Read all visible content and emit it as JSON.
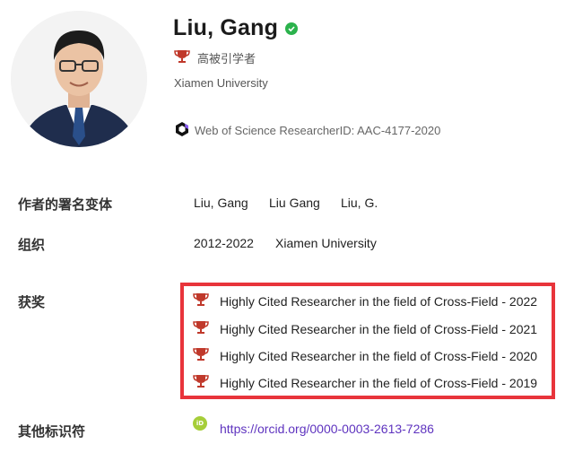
{
  "profile": {
    "name": "Liu, Gang",
    "badge_label": "高被引学者",
    "affiliation": "Xiamen University",
    "researcher_id": "Web of Science ResearcherID: AAC-4177-2020"
  },
  "name_variants": {
    "label": "作者的署名变体",
    "items": [
      "Liu, Gang",
      "Liu Gang",
      "Liu, G."
    ]
  },
  "organization": {
    "label": "组织",
    "years": "2012-2022",
    "name": "Xiamen University"
  },
  "awards": {
    "label": "获奖",
    "items": [
      "Highly Cited Researcher in the field of Cross-Field - 2022",
      "Highly Cited Researcher in the field of Cross-Field - 2021",
      "Highly Cited Researcher in the field of Cross-Field - 2020",
      "Highly Cited Researcher in the field of Cross-Field - 2019"
    ]
  },
  "other_ids": {
    "label": "其他标识符",
    "orcid_icon_text": "iD",
    "orcid_url": "https://orcid.org/0000-0003-2613-7286"
  },
  "colors": {
    "trophy": "#c0392b",
    "verified": "#2bb24c",
    "highlight_border": "#e8343b",
    "link": "#5e33bf",
    "orcid": "#a6ce39"
  }
}
